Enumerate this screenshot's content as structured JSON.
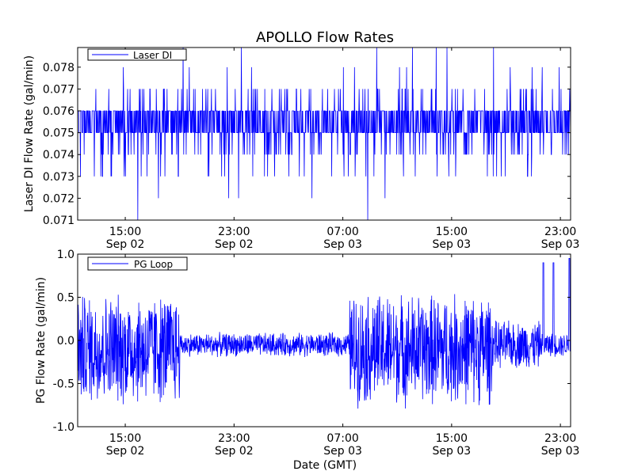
{
  "figure": {
    "title": "APOLLO Flow Rates",
    "xlabel": "Date (GMT)",
    "line_color": "#0000ff",
    "x_ticks": [
      {
        "day": "Sep 02",
        "time": "15:00"
      },
      {
        "day": "Sep 02",
        "time": "23:00"
      },
      {
        "day": "Sep 03",
        "time": "07:00"
      },
      {
        "day": "Sep 03",
        "time": "15:00"
      },
      {
        "day": "Sep 03",
        "time": "23:00"
      }
    ]
  },
  "chart_data": [
    {
      "type": "line",
      "title": "APOLLO Flow Rates",
      "ylabel": "Laser DI Flow Rate (gal/min)",
      "x_range": [
        "Sep 02 11:30",
        "Sep 03 23:45"
      ],
      "ylim": [
        0.071,
        0.0789
      ],
      "y_ticks": [
        "0.071",
        "0.072",
        "0.073",
        "0.074",
        "0.075",
        "0.076",
        "0.077",
        "0.078"
      ],
      "grid": false,
      "legend_position": "top-left",
      "series": [
        {
          "name": "Laser DI",
          "color": "#0000ff",
          "typical_band": [
            0.075,
            0.076
          ],
          "spike_values": [
            0.073,
            0.074,
            0.077,
            0.078
          ],
          "extreme_max": 0.0789,
          "extreme_min": 0.071
        }
      ]
    },
    {
      "type": "line",
      "ylabel": "PG Flow Rate (gal/min)",
      "xlabel": "Date (GMT)",
      "x_range": [
        "Sep 02 11:30",
        "Sep 03 23:45"
      ],
      "ylim": [
        -1.0,
        1.0
      ],
      "y_ticks": [
        "-1.0",
        "-0.5",
        "0.0",
        "0.5",
        "1.0"
      ],
      "grid": false,
      "legend_position": "top-left",
      "series": [
        {
          "name": "PG Loop",
          "color": "#0000ff",
          "segments": [
            {
              "from": "Sep 02 11:30",
              "to": "Sep 02 19:00",
              "center": -0.1,
              "amplitude": 0.7
            },
            {
              "from": "Sep 02 19:00",
              "to": "Sep 03 07:30",
              "center": -0.05,
              "amplitude": 0.15
            },
            {
              "from": "Sep 03 07:30",
              "to": "Sep 03 18:00",
              "center": -0.1,
              "amplitude": 0.7
            },
            {
              "from": "Sep 03 18:00",
              "to": "Sep 03 21:30",
              "center": -0.05,
              "amplitude": 0.3
            },
            {
              "from": "Sep 03 21:30",
              "to": "Sep 03 23:45",
              "center": -0.05,
              "amplitude": 0.15
            }
          ],
          "spikes": [
            {
              "at": "Sep 03 21:45",
              "value": 0.9
            },
            {
              "at": "Sep 03 22:30",
              "value": 0.9
            },
            {
              "at": "Sep 03 23:40",
              "value": 0.95
            }
          ]
        }
      ]
    }
  ]
}
